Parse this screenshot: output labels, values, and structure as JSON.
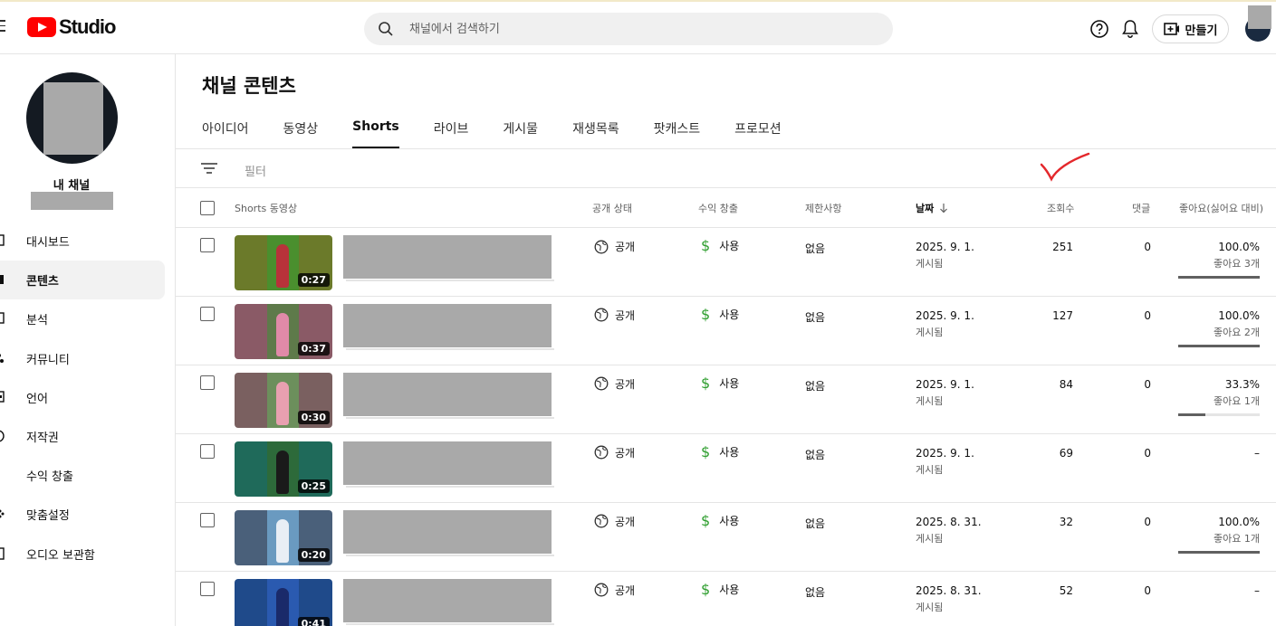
{
  "app": {
    "logo_text": "Studio",
    "brand_color": "#ff0000"
  },
  "search": {
    "placeholder": "채널에서 검색하기"
  },
  "header": {
    "create_label": "만들기"
  },
  "sidebar": {
    "channel_title": "내 채널",
    "items": [
      {
        "label": "대시보드",
        "icon": "dashboard-icon"
      },
      {
        "label": "콘텐츠",
        "icon": "content-icon",
        "active": true
      },
      {
        "label": "분석",
        "icon": "analytics-icon"
      },
      {
        "label": "커뮤니티",
        "icon": "community-icon"
      },
      {
        "label": "언어",
        "icon": "language-icon"
      },
      {
        "label": "저작권",
        "icon": "copyright-icon"
      },
      {
        "label": "수익 창출",
        "icon": "monetization-icon"
      },
      {
        "label": "맞춤설정",
        "icon": "customization-icon"
      },
      {
        "label": "오디오 보관함",
        "icon": "audio-library-icon"
      }
    ]
  },
  "main": {
    "title": "채널 콘텐츠",
    "tabs": [
      "아이디어",
      "동영상",
      "Shorts",
      "라이브",
      "게시물",
      "재생목록",
      "팟캐스트",
      "프로모션"
    ],
    "active_tab": "Shorts",
    "filter_label": "필터",
    "columns": {
      "video": "Shorts 동영상",
      "visibility": "공개 상태",
      "monetization": "수익 창출",
      "restrictions": "제한사항",
      "date": "날짜",
      "views": "조회수",
      "comments": "댓글",
      "likes": "좋아요(싫어요 대비)"
    },
    "rows": [
      {
        "duration": "0:27",
        "visibility": "공개",
        "monetization": "사용",
        "restrictions": "없음",
        "date": "2025. 9. 1.",
        "date_status": "게시됨",
        "views": "251",
        "comments": "0",
        "likes": "100.0%",
        "likes_sub": "좋아요 3개",
        "like_ratio": 1.0,
        "bg": "#6b7a2a",
        "center": "#4a8f2e",
        "figure": "#b8323a"
      },
      {
        "duration": "0:37",
        "visibility": "공개",
        "monetization": "사용",
        "restrictions": "없음",
        "date": "2025. 9. 1.",
        "date_status": "게시됨",
        "views": "127",
        "comments": "0",
        "likes": "100.0%",
        "likes_sub": "좋아요 2개",
        "like_ratio": 1.0,
        "bg": "#8a5a66",
        "center": "#5e7a4a",
        "figure": "#e08aa8"
      },
      {
        "duration": "0:30",
        "visibility": "공개",
        "monetization": "사용",
        "restrictions": "없음",
        "date": "2025. 9. 1.",
        "date_status": "게시됨",
        "views": "84",
        "comments": "0",
        "likes": "33.3%",
        "likes_sub": "좋아요 1개",
        "like_ratio": 0.333,
        "bg": "#7a6060",
        "center": "#6c8f5c",
        "figure": "#e8a0b0"
      },
      {
        "duration": "0:25",
        "visibility": "공개",
        "monetization": "사용",
        "restrictions": "없음",
        "date": "2025. 9. 1.",
        "date_status": "게시됨",
        "views": "69",
        "comments": "0",
        "likes": "–",
        "likes_sub": "",
        "like_ratio": null,
        "bg": "#1f6a5a",
        "center": "#2d6a3a",
        "figure": "#1a1a1a"
      },
      {
        "duration": "0:20",
        "visibility": "공개",
        "monetization": "사용",
        "restrictions": "없음",
        "date": "2025. 8. 31.",
        "date_status": "게시됨",
        "views": "32",
        "comments": "0",
        "likes": "100.0%",
        "likes_sub": "좋아요 1개",
        "like_ratio": 1.0,
        "bg": "#4a607a",
        "center": "#6a9ac0",
        "figure": "#e8eef5"
      },
      {
        "duration": "0:41",
        "visibility": "공개",
        "monetization": "사용",
        "restrictions": "없음",
        "date": "2025. 8. 31.",
        "date_status": "게시됨",
        "views": "52",
        "comments": "0",
        "likes": "–",
        "likes_sub": "",
        "like_ratio": null,
        "bg": "#1f4a8a",
        "center": "#2a5ab0",
        "figure": "#1a2a6a"
      }
    ]
  }
}
